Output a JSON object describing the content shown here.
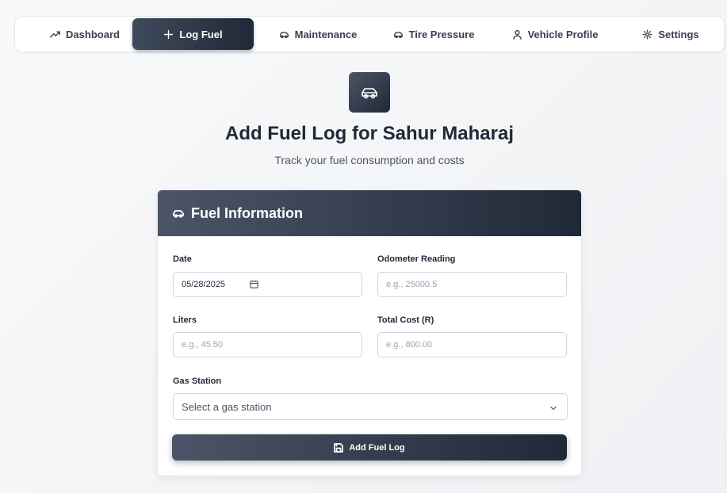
{
  "nav": {
    "tabs": [
      {
        "label": "Dashboard",
        "icon": "trending-up-icon",
        "active": false
      },
      {
        "label": "Log Fuel",
        "icon": "plus-icon",
        "active": true
      },
      {
        "label": "Maintenance",
        "icon": "car-icon",
        "active": false
      },
      {
        "label": "Tire Pressure",
        "icon": "car-icon",
        "active": false
      },
      {
        "label": "Vehicle Profile",
        "icon": "user-icon",
        "active": false
      },
      {
        "label": "Settings",
        "icon": "gear-icon",
        "active": false
      }
    ]
  },
  "header": {
    "icon": "car-icon",
    "title": "Add Fuel Log for Sahur Maharaj",
    "subtitle": "Track your fuel consumption and costs"
  },
  "card": {
    "title": "Fuel Information",
    "icon": "car-icon"
  },
  "form": {
    "date_label": "Date",
    "date_value": "05/28/2025",
    "odometer_label": "Odometer Reading",
    "odometer_placeholder": "e.g., 25000.5",
    "liters_label": "Liters",
    "liters_placeholder": "e.g., 45.50",
    "cost_label": "Total Cost (R)",
    "cost_placeholder": "e.g., 800.00",
    "station_label": "Gas Station",
    "station_placeholder": "Select a gas station",
    "submit_label": "Add Fuel Log"
  },
  "colors": {
    "accent_dark": "#1f2937",
    "accent_light": "#4b5567",
    "background": "#f3f4f6"
  }
}
